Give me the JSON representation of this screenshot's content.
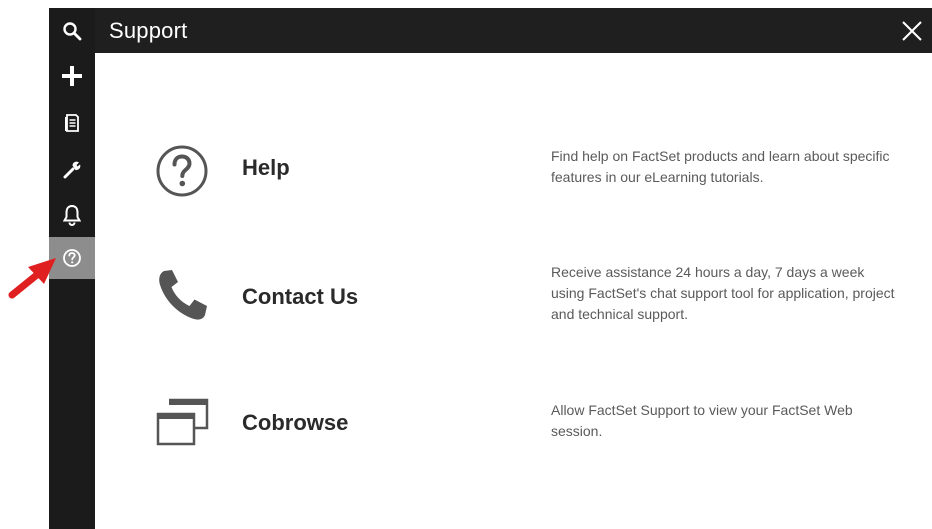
{
  "sidebar": {
    "items": [
      {
        "icon": "search-icon"
      },
      {
        "icon": "plus-icon"
      },
      {
        "icon": "document-icon"
      },
      {
        "icon": "wrench-icon"
      },
      {
        "icon": "bell-icon"
      },
      {
        "icon": "help-icon",
        "active": true
      }
    ],
    "active_color": "#8d8d8d",
    "background": "#1b1b1b"
  },
  "header": {
    "title": "Support",
    "close_icon": "close-icon",
    "background": "#1f1f1f"
  },
  "support": {
    "options": [
      {
        "icon": "help-circle-icon",
        "title": "Help",
        "description": "Find help on FactSet products and learn about specific features in our eLearning tutorials."
      },
      {
        "icon": "phone-icon",
        "title": "Contact Us",
        "description": "Receive assistance 24 hours a day, 7 days a week using FactSet's chat support tool for application, project and technical support."
      },
      {
        "icon": "cobrowse-windows-icon",
        "title": "Cobrowse",
        "description": "Allow FactSet Support to view your FactSet Web session."
      }
    ]
  },
  "annotation": {
    "icon": "red-arrow-icon",
    "color": "#e02020"
  }
}
